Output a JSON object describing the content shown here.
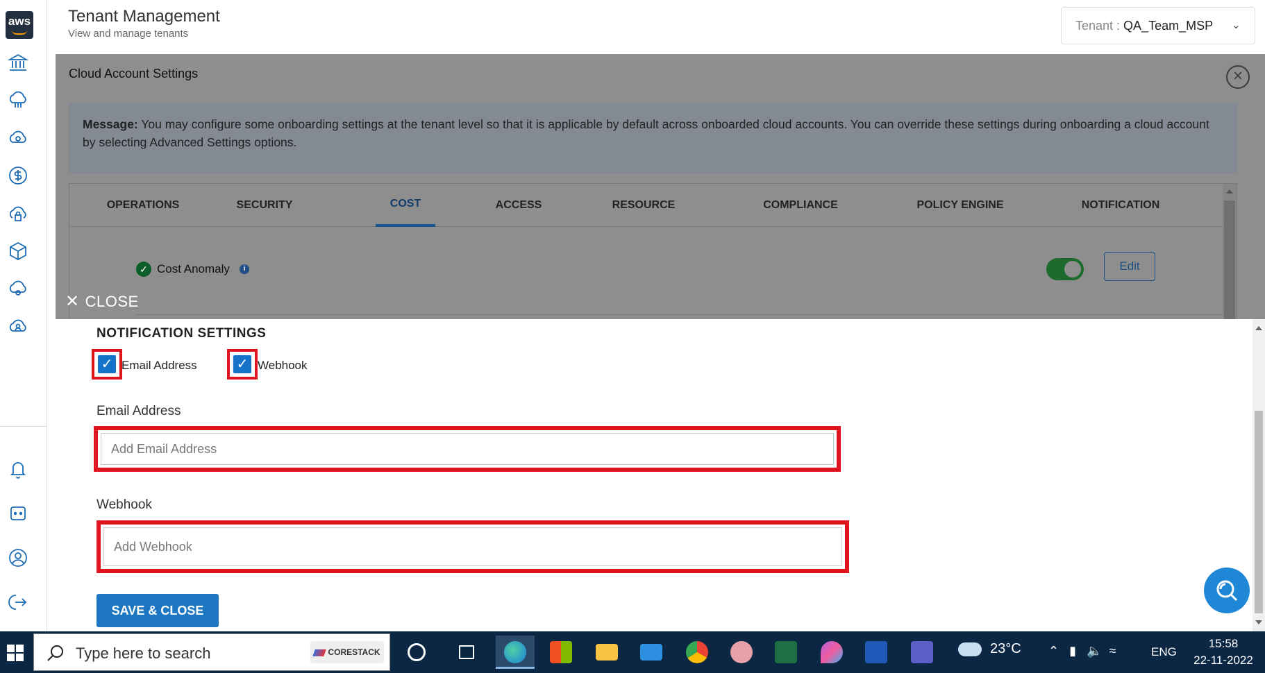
{
  "header": {
    "title": "Tenant Management",
    "subtitle": "View and manage tenants",
    "tenant_label": "Tenant : ",
    "tenant_value": "QA_Team_MSP"
  },
  "sidebar": {
    "logo_text": "aws",
    "icons": [
      "bank-icon",
      "cloud-network-icon",
      "cloud-sync-icon",
      "dollar-icon",
      "cloud-lock-icon",
      "cube-icon",
      "cloud-gear-icon",
      "cloud-user-icon",
      "bell-icon",
      "chatbot-icon",
      "user-circle-icon",
      "logout-icon"
    ]
  },
  "settings_panel": {
    "title": "Cloud Account Settings",
    "message_label": "Message:",
    "message_text": " You may configure some onboarding settings at the tenant level so that it is applicable by default across onboarded cloud accounts. You can override these settings during onboarding a cloud account by selecting Advanced Settings options.",
    "tabs": [
      "OPERATIONS",
      "SECURITY",
      "COST",
      "ACCESS",
      "RESOURCE",
      "COMPLIANCE",
      "POLICY ENGINE",
      "NOTIFICATION"
    ],
    "active_tab": "COST",
    "cost_anomaly_label": "Cost Anomaly",
    "cost_anomaly_enabled": true,
    "edit_label": "Edit"
  },
  "drawer": {
    "close_label": "CLOSE",
    "title": "NOTIFICATION SETTINGS",
    "email_checkbox_label": "Email Address",
    "webhook_checkbox_label": "Webhook",
    "email_checked": true,
    "webhook_checked": true,
    "email_field_label": "Email Address",
    "email_placeholder": "Add Email Address",
    "webhook_field_label": "Webhook",
    "webhook_placeholder": "Add Webhook",
    "save_label": "SAVE & CLOSE"
  },
  "taskbar": {
    "search_placeholder": "Type here to search",
    "corestack_label": "CORESTACK",
    "weather": "23°C",
    "language": "ENG",
    "time": "15:58",
    "date": "22-11-2022",
    "apps": [
      "cortana-icon",
      "task-view-icon",
      "edge-icon",
      "store-icon",
      "file-explorer-icon",
      "mail-icon",
      "chrome-icon",
      "snipping-tool-icon",
      "excel-icon",
      "paint-icon",
      "word-icon",
      "teams-icon"
    ]
  },
  "colors": {
    "accent": "#1c76c2",
    "highlight_border": "#e0141e",
    "taskbar": "#0c2744"
  }
}
